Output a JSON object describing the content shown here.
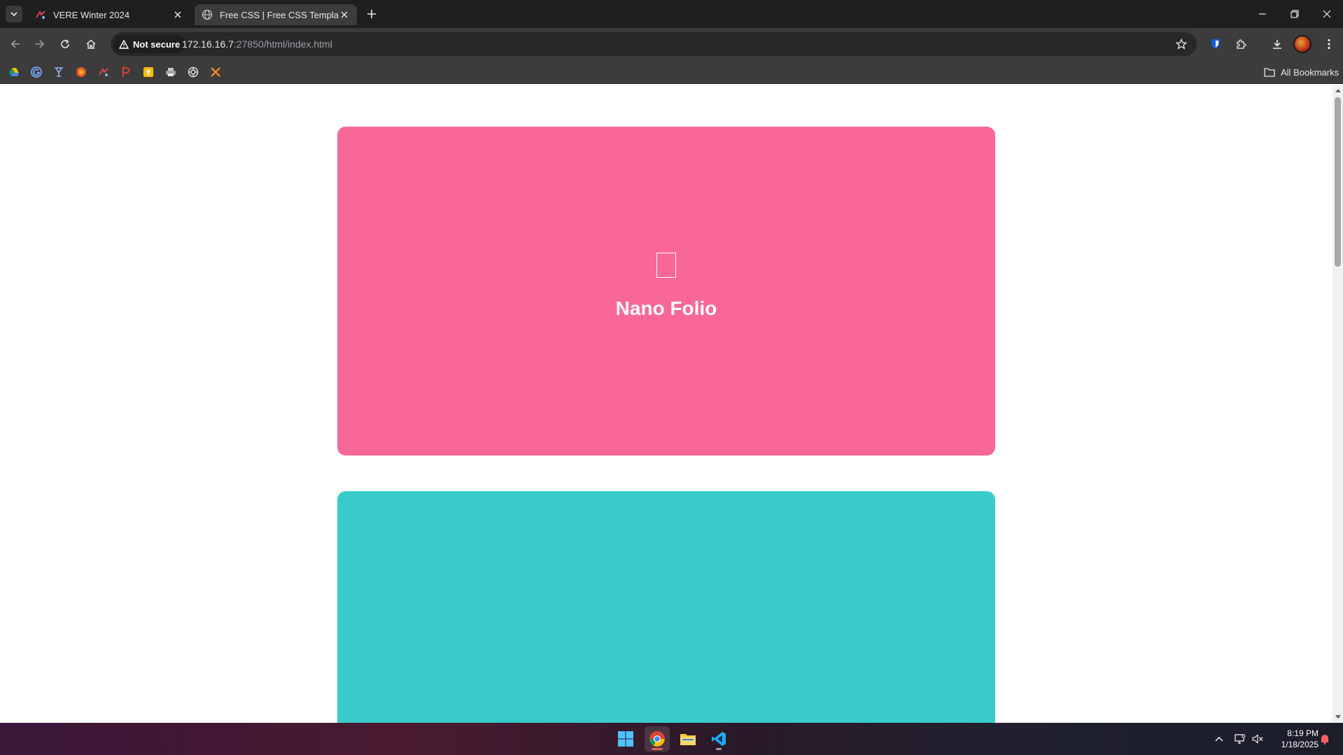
{
  "browser": {
    "tabs": [
      {
        "title": "VERE Winter 2024",
        "active": false,
        "icon": "vere-logo-icon"
      },
      {
        "title": "Free CSS | Free CSS Templates |",
        "active": true,
        "icon": "globe-icon"
      }
    ],
    "address_bar": {
      "security_label": "Not secure",
      "url_host": "172.16.16.7",
      "url_rest": ":27850/html/index.html"
    },
    "bookmarks": {
      "icons": [
        "google-drive-icon",
        "grammarly-icon",
        "yale-icon",
        "firefox-like-icon",
        "vere-icon",
        "p-icon",
        "keep-icon",
        "printer-icon",
        "openai-icon",
        "x-icon"
      ],
      "all_label": "All Bookmarks"
    }
  },
  "page": {
    "cards": [
      {
        "title": "Nano Folio",
        "color": "#f86798"
      },
      {
        "title": "",
        "color": "#39cbcc"
      }
    ]
  },
  "taskbar": {
    "apps": [
      "windows-start-icon",
      "chrome-icon",
      "file-explorer-icon",
      "vscode-icon"
    ],
    "time": "8:19 PM",
    "date": "1/18/2025"
  }
}
